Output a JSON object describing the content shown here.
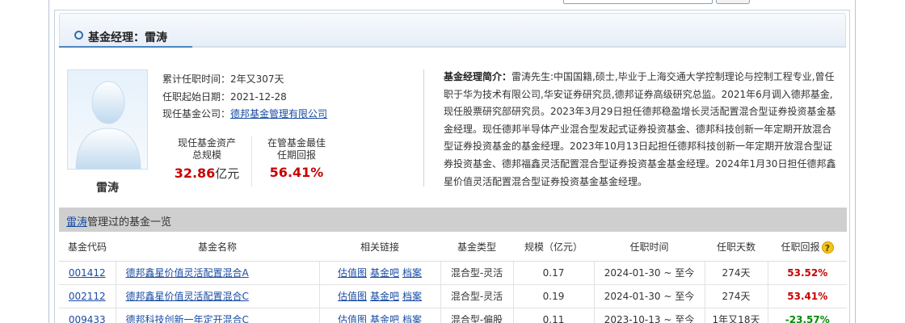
{
  "header": {
    "title": "基金经理：雷涛"
  },
  "manager": {
    "name": "雷涛",
    "tenure_total_label": "累计任职时间：",
    "tenure_total": "2年又307天",
    "start_date_label": "任职起始日期：",
    "start_date": "2021-12-28",
    "company_label": "现任基金公司：",
    "company": "德邦基金管理有限公司"
  },
  "stats": {
    "assets_label_1": "现任基金资产",
    "assets_label_2": "总规模",
    "assets_value": "32.86",
    "assets_unit": "亿元",
    "best_return_label_1": "在管基金最佳",
    "best_return_label_2": "任期回报",
    "best_return_value": "56.41%"
  },
  "bio": {
    "label": "基金经理简介：",
    "text": "雷涛先生:中国国籍,硕士,毕业于上海交通大学控制理论与控制工程专业,曾任职于华为技术有限公司,华安证券研究员,德邦证券高级研究总监。2021年6月调入德邦基金,现任股票研究部研究员。2023年3月29日担任德邦稳盈增长灵活配置混合型证券投资基金基金经理。现任德邦半导体产业混合型发起式证券投资基金、德邦科技创新一年定期开放混合型证券投资基金的基金经理。2023年10月13日起担任德邦科技创新一年定期开放混合型证券投资基金、德邦福鑫灵活配置混合型证券投资基金基金经理。2024年1月30日担任德邦鑫星价值灵活配置混合型证券投资基金基金经理。"
  },
  "fund_list": {
    "manager_link": "雷涛",
    "title_suffix": "管理过的基金一览",
    "columns": [
      "基金代码",
      "基金名称",
      "相关链接",
      "基金类型",
      "规模（亿元）",
      "任职时间",
      "任职天数",
      "任职回报"
    ],
    "related_links": [
      "估值图",
      "基金吧",
      "档案"
    ],
    "rows": [
      {
        "code": "001412",
        "name": "德邦鑫星价值灵活配置混合A",
        "type": "混合型-灵活",
        "size": "0.17",
        "period": "2024-01-30 ~ 至今",
        "days": "274天",
        "return": "53.52%",
        "positive": true
      },
      {
        "code": "002112",
        "name": "德邦鑫星价值灵活配置混合C",
        "type": "混合型-灵活",
        "size": "0.19",
        "period": "2024-01-30 ~ 至今",
        "days": "274天",
        "return": "53.41%",
        "positive": true
      },
      {
        "code": "009433",
        "name": "德邦科技创新一年定开混合C",
        "type": "混合型-偏股",
        "size": "0.11",
        "period": "2023-10-13 ~ 至今",
        "days": "1年又18天",
        "return": "-23.57%",
        "positive": false
      }
    ]
  },
  "icons": {
    "title_bullet": "circle-bullet-icon",
    "help": "question-help-icon",
    "avatar": "user-silhouette-icon"
  },
  "colors": {
    "accent": "#2f6fb2",
    "positive": "#c80000",
    "negative": "#0a8a0a",
    "link": "#1a4ca3"
  }
}
